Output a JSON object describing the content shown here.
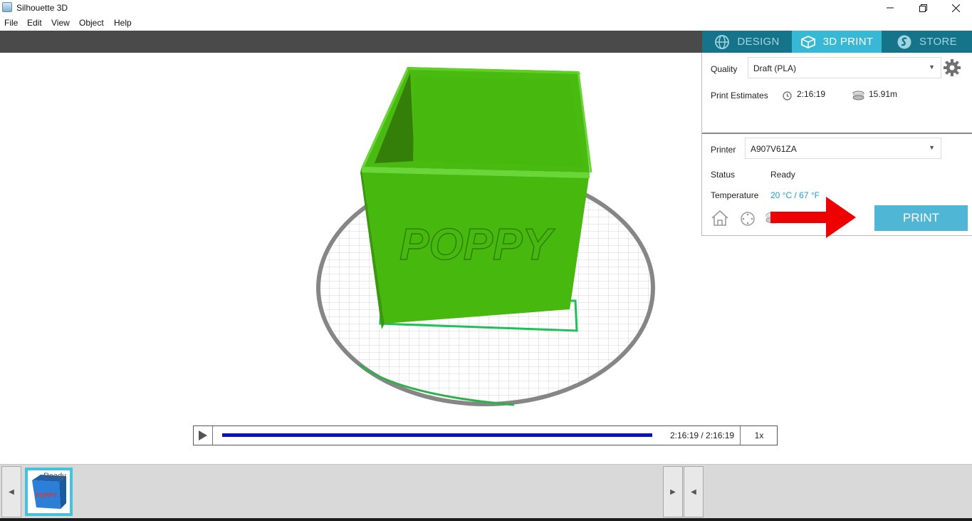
{
  "window": {
    "title": "Silhouette 3D"
  },
  "menu": {
    "items": [
      "File",
      "Edit",
      "View",
      "Object",
      "Help"
    ]
  },
  "tabs": [
    {
      "label": "DESIGN",
      "icon": "globe-icon"
    },
    {
      "label": "3D PRINT",
      "icon": "print-cube-icon",
      "active": true
    },
    {
      "label": "STORE",
      "icon": "silhouette-s-icon"
    }
  ],
  "panel": {
    "quality_label": "Quality",
    "quality_value": "Draft (PLA)",
    "estimates_label": "Print Estimates",
    "time_estimate": "2:16:19",
    "filament_estimate": "15.91m",
    "printer_label": "Printer",
    "printer_value": "A907V61ZA",
    "status_label": "Status",
    "status_value": "Ready",
    "temperature_label": "Temperature",
    "temperature_value": "20 °C / 67 °F",
    "print_button": "PRINT"
  },
  "viewport": {
    "model_text": "POPPY"
  },
  "playback": {
    "time": "2:16:19 / 2:16:19",
    "speed": "1x",
    "progress": 1.0
  },
  "queue": {
    "items": [
      {
        "status": "Ready",
        "thumbnail_text": "POPPY"
      }
    ]
  },
  "colors": {
    "accent": "#37b8d4",
    "tab_inactive": "#16748a",
    "model_green": "#47b80e",
    "progress_blue": "#0a12b8",
    "arrow_red": "#ee0000",
    "temperature_text": "#1a9ed6"
  }
}
